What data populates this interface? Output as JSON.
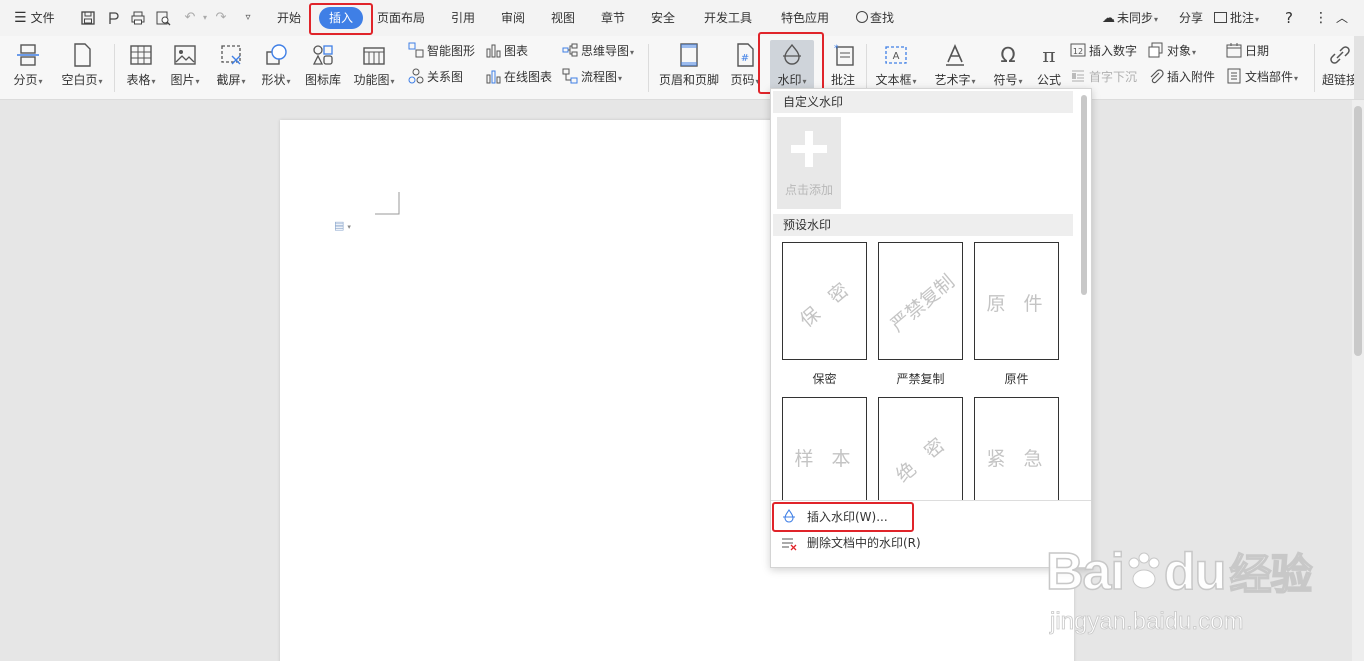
{
  "menubar": {
    "file_label": "文件",
    "tabs": [
      {
        "id": "start",
        "label": "开始"
      },
      {
        "id": "insert",
        "label": "插入"
      },
      {
        "id": "layout",
        "label": "页面布局"
      },
      {
        "id": "reference",
        "label": "引用"
      },
      {
        "id": "review",
        "label": "审阅"
      },
      {
        "id": "view",
        "label": "视图"
      },
      {
        "id": "chapter",
        "label": "章节"
      },
      {
        "id": "security",
        "label": "安全"
      },
      {
        "id": "devtools",
        "label": "开发工具"
      },
      {
        "id": "features",
        "label": "特色应用"
      }
    ],
    "active_tab": "插入",
    "search_label": "查找",
    "sync_label": "未同步",
    "share_label": "分享",
    "comment_label": "批注"
  },
  "ribbon": {
    "page_break": "分页",
    "blank_page": "空白页",
    "table": "表格",
    "picture": "图片",
    "screenshot": "截屏",
    "shape": "形状",
    "icon_lib": "图标库",
    "func_chart": "功能图",
    "smart_shape": "智能图形",
    "relation": "关系图",
    "chart": "图表",
    "online_chart": "在线图表",
    "mindmap": "思维导图",
    "flowchart": "流程图",
    "header_footer": "页眉和页脚",
    "page_number": "页码",
    "watermark": "水印",
    "comment": "批注",
    "textbox": "文本框",
    "wordart": "艺术字",
    "symbol": "符号",
    "formula": "公式",
    "insert_number": "插入数字",
    "drop_cap": "首字下沉",
    "object": "对象",
    "attachment": "插入附件",
    "date": "日期",
    "doc_parts": "文档部件",
    "hyperlink": "超链接"
  },
  "watermark_panel": {
    "custom_header": "自定义水印",
    "add_label": "点击添加",
    "preset_header": "预设水印",
    "presets": [
      {
        "name": "保密",
        "text": "保 密"
      },
      {
        "name": "严禁复制",
        "text": "严禁复制"
      },
      {
        "name": "原件",
        "text": "原 件"
      },
      {
        "name": "样本",
        "text": "样 本"
      },
      {
        "name": "绝密",
        "text": "绝 密"
      },
      {
        "name": "紧急",
        "text": "紧 急"
      }
    ],
    "insert_item": "插入水印(W)...",
    "delete_item": "删除文档中的水印(R)"
  },
  "baidu_watermark": {
    "brand": "Bai",
    "brand_tail": "du",
    "cn": "经验",
    "url": "jingyan.baidu.com"
  },
  "colors": {
    "accent": "#3f7fe6",
    "highlight_red": "#e0242a"
  }
}
